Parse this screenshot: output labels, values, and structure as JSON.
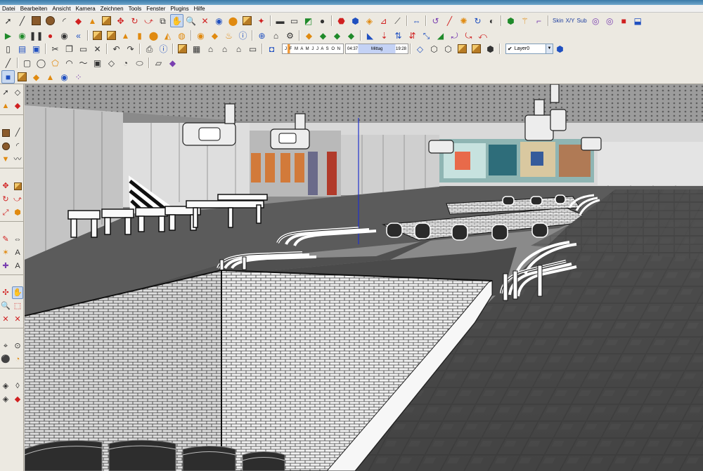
{
  "window": {
    "title": ""
  },
  "menu": [
    "Datei",
    "Bearbeiten",
    "Ansicht",
    "Kamera",
    "Zeichnen",
    "Tools",
    "Fenster",
    "Plugins",
    "Hilfe"
  ],
  "shadow": {
    "months": "J F M A M J J A S O N D",
    "time_start": "04:37",
    "time_mid": "Mittag",
    "time_end": "19:28"
  },
  "layer": {
    "current": "Layer0"
  },
  "plugins": {
    "skin": "Skin",
    "xy": "X/Y",
    "sub": "Sub"
  },
  "colors": {
    "accent": "#2a6db0",
    "toolbar_bg": "#ece9e1",
    "viewport_sky": "#8a8a8a"
  }
}
